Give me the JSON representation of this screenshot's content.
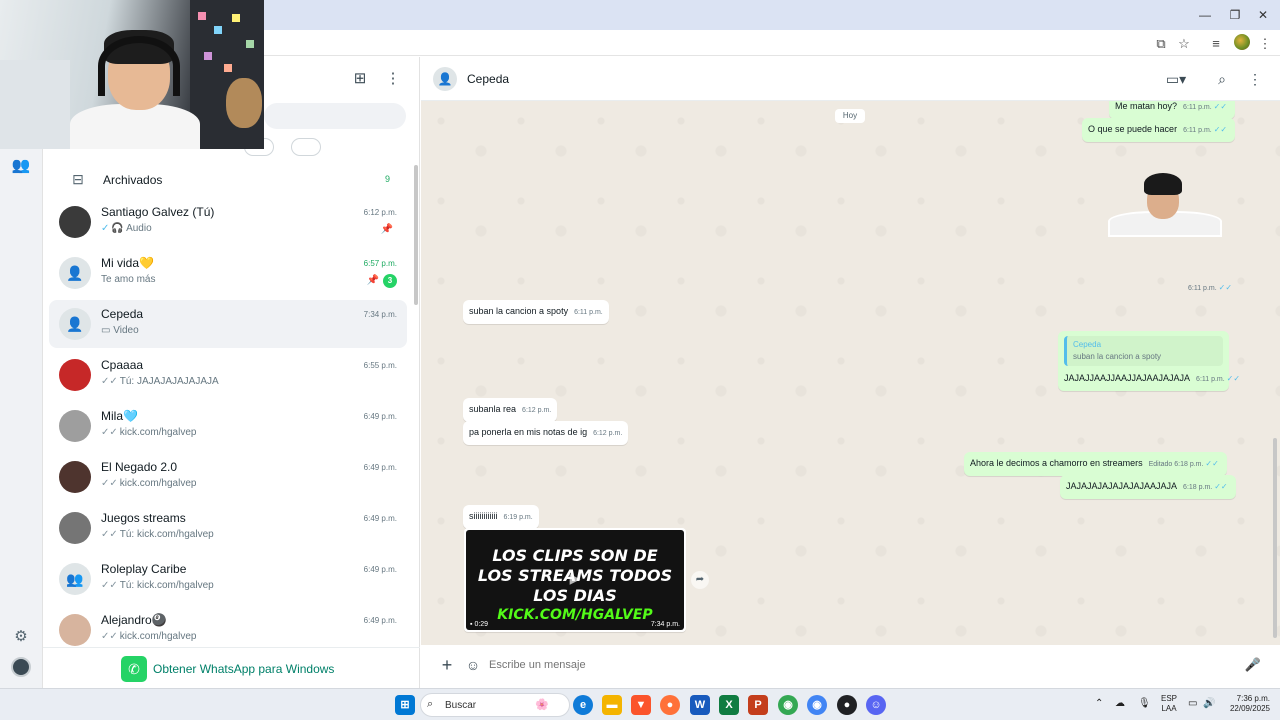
{
  "chat_list": {
    "archived": {
      "label": "Archivados",
      "count": "9"
    },
    "chats": [
      {
        "name": "Santiago Galvez (Tú)",
        "preview": "Audio",
        "time": "6:12 p.m.",
        "pinned": true,
        "ticks": "✓",
        "icon": "headphones-icon"
      },
      {
        "name": "Mi vida💛",
        "preview": "Te amo más",
        "time": "6:57 p.m.",
        "pinned": true,
        "unread": "3"
      },
      {
        "name": "Cepeda",
        "preview": "Video",
        "time": "7:34 p.m.",
        "selected": true,
        "icon": "video-icon"
      },
      {
        "name": "Cpaaaa",
        "preview": "Tú: JAJAJAJAJAJAJA",
        "time": "6:55 p.m.",
        "ticks": "✓✓"
      },
      {
        "name": "Mila🩵",
        "preview": "kick.com/hgalvep",
        "time": "6:49 p.m.",
        "ticks": "✓✓"
      },
      {
        "name": "El Negado 2.0",
        "preview": "kick.com/hgalvep",
        "time": "6:49 p.m.",
        "ticks": "✓✓"
      },
      {
        "name": "Juegos streams",
        "preview": "Tú: kick.com/hgalvep",
        "time": "6:49 p.m.",
        "ticks": "✓✓"
      },
      {
        "name": "Roleplay Caribe",
        "preview": "Tú: kick.com/hgalvep",
        "time": "6:49 p.m.",
        "ticks": "✓✓"
      },
      {
        "name": "Alejandro🎱",
        "preview": "kick.com/hgalvep",
        "time": "6:49 p.m.",
        "ticks": "✓✓"
      }
    ],
    "get_whatsapp": "Obtener WhatsApp para Windows"
  },
  "conversation": {
    "contact_name": "Cepeda",
    "date_chip": "Hoy",
    "messages": {
      "m1": {
        "text": "Me matan hoy?",
        "time": "6:11 p.m."
      },
      "m2": {
        "text": "O que se puede hacer",
        "time": "6:11 p.m."
      },
      "m3_time": "6:11 p.m.",
      "m4": {
        "text": "suban la cancion a spoty",
        "time": "6:11 p.m."
      },
      "m5": {
        "quote_author": "Cepeda",
        "quote_text": "suban la cancion a spoty",
        "text": "JAJAJJAAJJAAJJAJAAJAJAJA",
        "time": "6:11 p.m."
      },
      "m6": {
        "text": "subanla rea",
        "time": "6:12 p.m."
      },
      "m7": {
        "text": "pa ponerla en mis notas de ig",
        "time": "6:12 p.m."
      },
      "m8": {
        "text": "Ahora le decimos a chamorro en streamers",
        "time": "Editado 6:18 p.m."
      },
      "m9": {
        "text": "JAJAJAJAJAJAJAJAAJAJA",
        "time": "6:18 p.m."
      },
      "m10": {
        "text": "siiiiiiiiiiii",
        "time": "6:19 p.m."
      },
      "video": {
        "line1": "LOS CLIPS SON DE",
        "line2": "LOS STREAMS TODOS",
        "line3": "LOS DIAS",
        "line4": "KICK.COM/HGALVEP",
        "duration": "0:29",
        "time": "7:34 p.m."
      }
    },
    "composer_placeholder": "Escribe un mensaje"
  },
  "taskbar": {
    "search_label": "Buscar",
    "lang_line1": "ESP",
    "lang_line2": "LAA",
    "time": "7:36 p.m.",
    "date": "22/09/2025"
  },
  "colors": {
    "accent": "#25d366",
    "outgoing_bubble": "#d9fdd3",
    "chat_bg": "#efeae2",
    "read_tick": "#53bdeb"
  }
}
